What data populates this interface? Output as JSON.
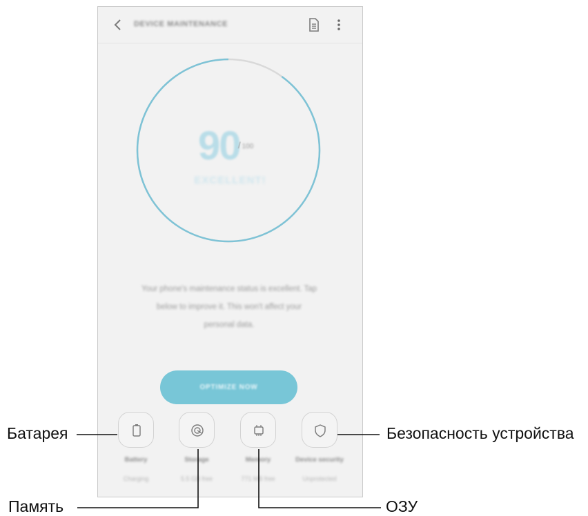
{
  "app": {
    "title": "DEVICE MAINTENANCE"
  },
  "score": {
    "value": "90",
    "separator": "/",
    "max": "100",
    "status": "EXCELLENT!",
    "ring_fraction": 0.9
  },
  "description": [
    "Your phone's maintenance status is excellent. Tap",
    "below to improve it. This won't affect your",
    "personal data."
  ],
  "optimize_label": "OPTIMIZE NOW",
  "tiles": [
    {
      "name": "Battery",
      "value": "Charging",
      "icon": "battery-icon"
    },
    {
      "name": "Storage",
      "value": "5.5 GB free",
      "icon": "storage-icon"
    },
    {
      "name": "Memory",
      "value": "771 MB free",
      "icon": "memory-chip-icon"
    },
    {
      "name": "Device security",
      "value": "Unprotected",
      "icon": "shield-icon"
    }
  ],
  "callouts": {
    "battery": "Батарея",
    "storage": "Память",
    "memory": "ОЗУ",
    "security": "Безопасность устройства"
  },
  "colors": {
    "accent": "#78c6d7",
    "ring": "#7ec3d6",
    "ring_track": "#d9d9d9",
    "background": "#f2f2f2"
  }
}
